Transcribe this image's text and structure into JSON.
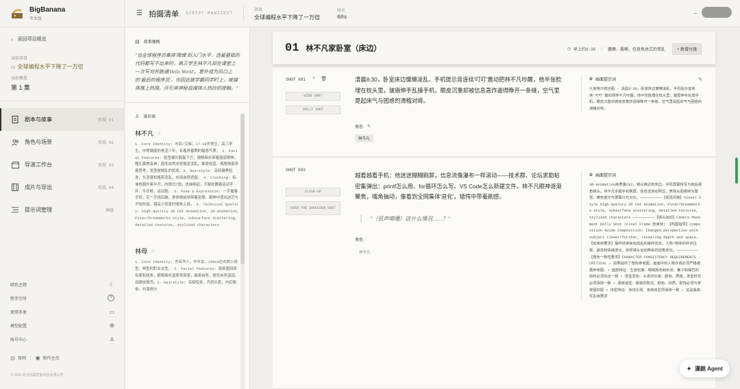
{
  "brand": {
    "name": "BigBanana",
    "edition": "专业版"
  },
  "sidebar": {
    "back": "返回项目概览",
    "current_label": "当前项目",
    "current_value": "全球编程水平下降了一万倍",
    "episode_label": "当前集数",
    "episode_value": "第 1 集",
    "nav": [
      {
        "label": "剧本与故事",
        "tag": "阶段 01",
        "icon": "document-icon"
      },
      {
        "label": "角色与场景",
        "tag": "阶段 02",
        "icon": "people-icon"
      },
      {
        "label": "导演工作台",
        "tag": "阶段 03",
        "icon": "clapper-icon"
      },
      {
        "label": "成片与导出",
        "tag": "阶段 04",
        "icon": "film-icon"
      },
      {
        "label": "提示词管理",
        "tag": "高级",
        "icon": "list-icon"
      }
    ],
    "utils": [
      {
        "label": "暗色主题",
        "icon": "moon-icon",
        "glyph": "☾"
      },
      {
        "label": "新手引导",
        "icon": "help-icon",
        "glyph": "?"
      },
      {
        "label": "使用手册",
        "icon": "book-icon",
        "glyph": "▭"
      },
      {
        "label": "模型配置",
        "icon": "gear-icon",
        "glyph": "⚙"
      },
      {
        "label": "账号中心",
        "icon": "user-icon",
        "glyph": "♙"
      }
    ],
    "footer_site": "官网",
    "footer_author": "制作主页",
    "copyright": "© 2026 武汉创巢智能科技有限公司"
  },
  "topbar": {
    "title": "拍摄清单",
    "manifest": "SCRIPT MANIFEST",
    "project_label": "项目",
    "project_value": "全球编程水平下降了一万倍",
    "duration_label": "时长",
    "duration_value": "60s"
  },
  "middle": {
    "story_header": "故事梗概",
    "story_text": "\"当全球程序员集体'降维'到入门水平，连最基础的代码都写不出来时，高三学生林不凡却在课堂上一次写对并跑通'Hello World'。意外成为风口上的'最后的程序员'，也因此被学霸同学盯上，被媒体推上热搜。开引来神秘自媒体人热炒的接触。\"",
    "cast_header": "演员表",
    "characters": [
      {
        "name": "林不凡",
        "desc": "1. Core Identity: 东亚/汉族；17-18岁男生，高三学生，中等偏瘦的青涩少年，有着青春期的敏感气质。 2. Facial Features: 脸型偏长鹅蛋下巴，眼睛细长带着困惑眼神，瞳孔聚焦有神，眉毛自然浓密略显凌乱，鼻梁挺直，嘴唇微抿带着思考，发型是微乱的短发。3. Hairstyle: 深棕偏黑短发，头顶蓬松略带凌乱，刘海自然遮额。 4. Clothing: 标准校服外套半开，内搭白T恤，衣袖卷起，手腕处戴着运动手环，牛仔裤，运动鞋。 5. Pose & Expression: 一手握着手机，另一手挠后脑，身体微前倾带着犹豫，眼神中透出迷茫与不知所措，偶有小惊喜时嘴角上扬。 6. Technical Quality: high-quality 3D CGI animation, 3d-animation, Pixar/DreamWorks style, subsurface scattering, detailed textures, stylized characters"
      },
      {
        "name": "林母",
        "desc": "1. Core Identity: 东亚华人，中年女，160cm左右娇小体型，典型的职业女性。 2. Facial Features: 面部圆润带有柔和线条，眼睛细长温柔带笑意，鼻梁自然，唇色自然温润，双眼皮微弯。3. Hairstyle: 深棕短发，齐肩长度，内扣微卷，刘海侧分"
      }
    ]
  },
  "scene": {
    "number": "01",
    "name": "林不凡家卧室（床边）",
    "time": "早上约8:30",
    "mood": "慵懒、晨曦、信息焦虑式的慌乱",
    "add_button": "+ 新增分镜"
  },
  "shots": [
    {
      "id": "SHOT 001",
      "chips": [
        "WIDE SHOT",
        "DOLLY SHOT"
      ],
      "text": "清晨8:30，卧室床边慵懒凌乱。手机提示音连续'叮叮'震动把林不凡吵醒，他半张脸埋在枕头里，皱眉伸手乱摸手机，眼皮沉重却被信息轰炸逼得睁开一条缝，空气里是起床气与困惑的滑稽对峙。",
      "role_label": "角色",
      "role": "林不凡",
      "panel_header": "画面提示词",
      "panel_text": "九宫格分镜全图 - 清晨8:30，卧室床边慵懒凌乱。手机提示音连续'叮叮'震动把林不凡吵醒，他半张脸埋在枕头里，皱眉伸手乱摸手机，眼皮沉重却被信息轰炸逼得睁开一条缝，空气里是起床气与困惑的滑稽对峙。"
    },
    {
      "id": "SHOT 002",
      "chips": [
        "CLOSE-UP",
        "OVER THE SHOULDER SHOT"
      ],
      "text": "越看越看手机：他迷迷糊糊刷屏，信息流像瀑布一样滚动——技术群、论坛求助帖密集弹出：printf怎么用、for循环怎么写、VS Code怎么新建文件。林不凡眼神逐渐聚焦，嘴角抽动，像看到全网集体'退化'，错愕中带着刷感。",
      "dialogue": "\"（低声嘟囔）这什么情况……？\"",
      "role_label": "角色",
      "role": "林不凡",
      "panel_header": "画面提示词",
      "panel_text": "3d-animation高质量CGI。镜头推近到床边，手机屏幕特写与肩后视角镜头。林不凡手握手机刷屏，信息流滚动明显，表情从困倦转为警觉，暖色窗光与屏幕冷光对比。——————————【视觉风格】Visual Style high-quality 3D CGI animation, Pixar/DreamWorks style, subsurface scattering, detailed textures, stylized characters ——————————【镜头运动】Camera Movement Dolly Shot (Final Frame 结束帧) 【构图指导】Composition Guide Composition: Changed perspective with subject closer/further, revealing depth and space. 【结束帧要求】最终结束帧完成后的最终状态，人物/物体的终点位置、姿态和情绪变化，体现镜头运动带来的视角变化。——————————【角色一致性要求】CHARACTER CONSISTENCY REQUIREMENTS - CRITICAL ⚠ 如果提供了角色参考图，画面中的人物外观必须严格遵循参考图：• 面部特征：五官轮廓、眼睛颜色和形状、鼻子和嘴巴的结构必须完全一致 • 发型发色：头发的长度、颜色、质感、发型样式必须保持一致 • 服装造型：服装的款式、颜色、材质、配饰必须与参考图匹配 • 体型特征：身材比例、身高体型须保持一致 ⚠ 这是最高优先级要求"
    }
  ],
  "agent_button": "漫剧 Agent",
  "colors": {
    "accent": "#7a6b2e",
    "scroll_indicator": "#3b9a5a"
  }
}
